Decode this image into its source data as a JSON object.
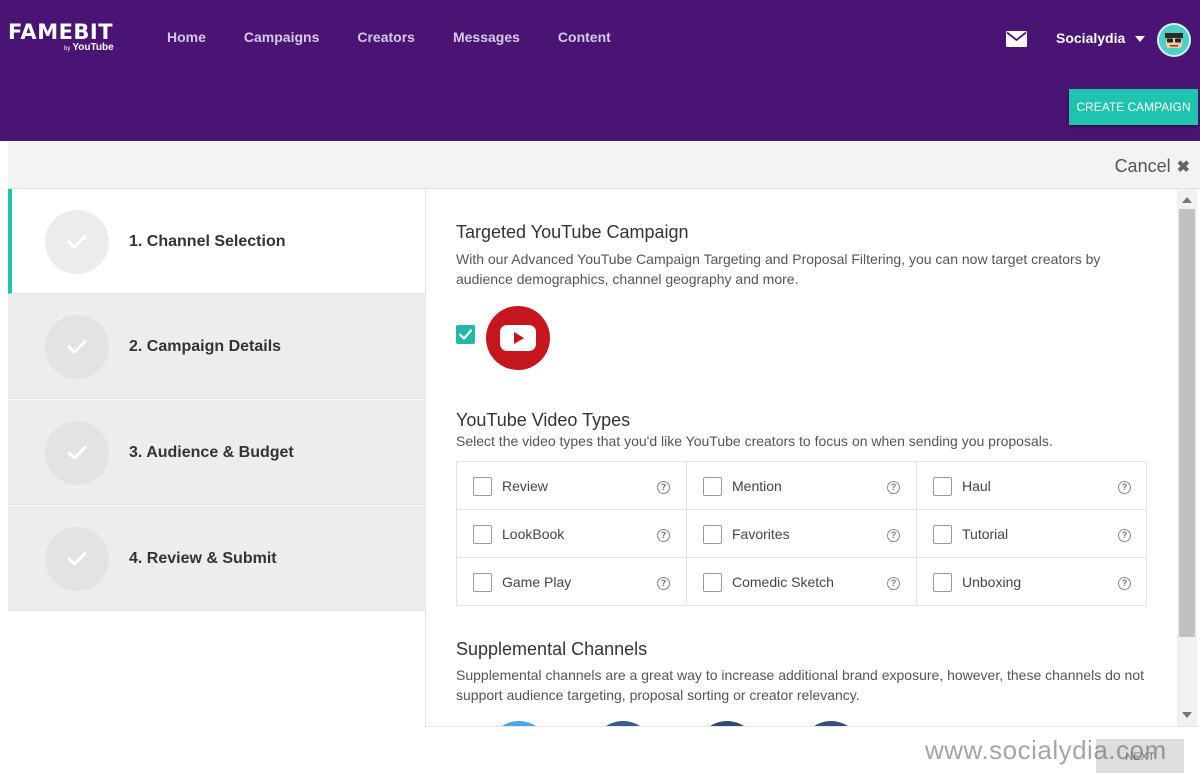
{
  "header": {
    "logo": "FAMEBIT",
    "logo_by": "by",
    "logo_sub": "YouTube",
    "nav": [
      "Home",
      "Campaigns",
      "Creators",
      "Messages",
      "Content"
    ],
    "user_name": "Socialydia",
    "create_button": "CREATE CAMPAIGN"
  },
  "cancel_label": "Cancel",
  "steps": [
    {
      "label": "1. Channel Selection",
      "active": true
    },
    {
      "label": "2. Campaign Details",
      "active": false
    },
    {
      "label": "3. Audience & Budget",
      "active": false
    },
    {
      "label": "4. Review & Submit",
      "active": false
    }
  ],
  "targeted": {
    "title": "Targeted YouTube Campaign",
    "description": "With our Advanced YouTube Campaign Targeting and Proposal Filtering, you can now target creators by audience demographics, channel geography and more.",
    "youtube_checked": true
  },
  "video_types": {
    "title": "YouTube Video Types",
    "description": "Select the video types that you'd like YouTube creators to focus on when sending you proposals.",
    "items": [
      "Review",
      "Mention",
      "Haul",
      "LookBook",
      "Favorites",
      "Tutorial",
      "Game Play",
      "Comedic Sketch",
      "Unboxing"
    ]
  },
  "supplemental": {
    "title": "Supplemental Channels",
    "description": "Supplemental channels are a great way to increase additional brand exposure, however, these channels do not support audience targeting, proposal sorting or creator relevancy."
  },
  "next_button": "NEXT",
  "watermark": "www.socialydia.com",
  "colors": {
    "header_purple": "#4a1474",
    "accent_teal": "#20c3ae",
    "youtube_red": "#c4161c"
  }
}
